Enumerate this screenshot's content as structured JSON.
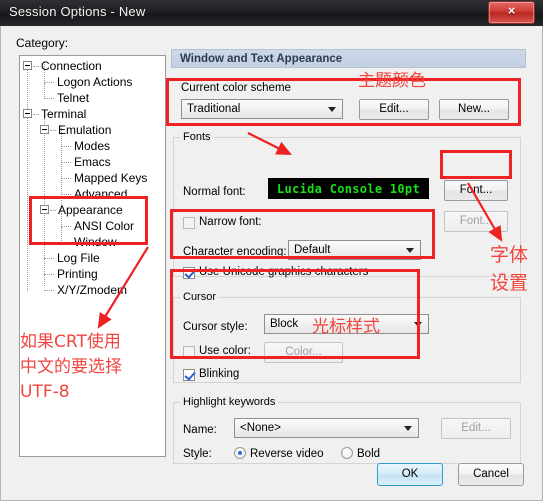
{
  "window": {
    "title": "Session Options - New",
    "close_label": "×"
  },
  "category": {
    "label": "Category:",
    "tree": [
      {
        "label": "Connection",
        "indent": 0,
        "expander": true
      },
      {
        "label": "Logon Actions",
        "indent": 1,
        "expander": false
      },
      {
        "label": "Telnet",
        "indent": 1,
        "expander": false
      },
      {
        "label": "Terminal",
        "indent": 0,
        "expander": true
      },
      {
        "label": "Emulation",
        "indent": 1,
        "expander": true
      },
      {
        "label": "Modes",
        "indent": 2,
        "expander": false
      },
      {
        "label": "Emacs",
        "indent": 2,
        "expander": false
      },
      {
        "label": "Mapped Keys",
        "indent": 2,
        "expander": false
      },
      {
        "label": "Advanced",
        "indent": 2,
        "expander": false
      },
      {
        "label": "Appearance",
        "indent": 1,
        "expander": true
      },
      {
        "label": "ANSI Color",
        "indent": 2,
        "expander": false
      },
      {
        "label": "Window",
        "indent": 2,
        "expander": false
      },
      {
        "label": "Log File",
        "indent": 1,
        "expander": false
      },
      {
        "label": "Printing",
        "indent": 1,
        "expander": false
      },
      {
        "label": "X/Y/Zmodem",
        "indent": 1,
        "expander": false
      }
    ]
  },
  "pane": {
    "header": "Window and Text Appearance",
    "color_scheme": {
      "label": "Current color scheme",
      "value": "Traditional",
      "edit_label": "Edit...",
      "new_label": "New..."
    },
    "fonts": {
      "group_label": "Fonts",
      "normal_font_label": "Normal font:",
      "normal_font_value": "Lucida Console 10pt",
      "normal_font_button": "Font...",
      "narrow_font_label": "Narrow font:",
      "narrow_font_button": "Font...",
      "narrow_font_checked": false,
      "encoding_label": "Character encoding:",
      "encoding_value": "Default",
      "unicode_label": "Use Unicode graphics characters",
      "unicode_checked": true
    },
    "cursor": {
      "group_label": "Cursor",
      "style_label": "Cursor style:",
      "style_value": "Block",
      "use_color_label": "Use color:",
      "use_color_checked": false,
      "color_button": "Color...",
      "blinking_label": "Blinking",
      "blinking_checked": true
    },
    "highlight": {
      "group_label": "Highlight keywords",
      "name_label": "Name:",
      "name_value": "<None>",
      "edit_label": "Edit...",
      "style_label": "Style:",
      "reverse_video_label": "Reverse video",
      "reverse_video_selected": true,
      "bold_label": "Bold",
      "bold_selected": false
    }
  },
  "footer": {
    "ok_label": "OK",
    "cancel_label": "Cancel"
  },
  "annotations": {
    "theme_color": "主题颜色",
    "font_settings_line1": "字体",
    "font_settings_line2": "设置",
    "cursor_style": "光标样式",
    "utf8_line1": "如果CRT使用",
    "utf8_line2": "中文的要选择",
    "utf8_line3": "UTF-8",
    "accent_color": "#ee2222"
  }
}
